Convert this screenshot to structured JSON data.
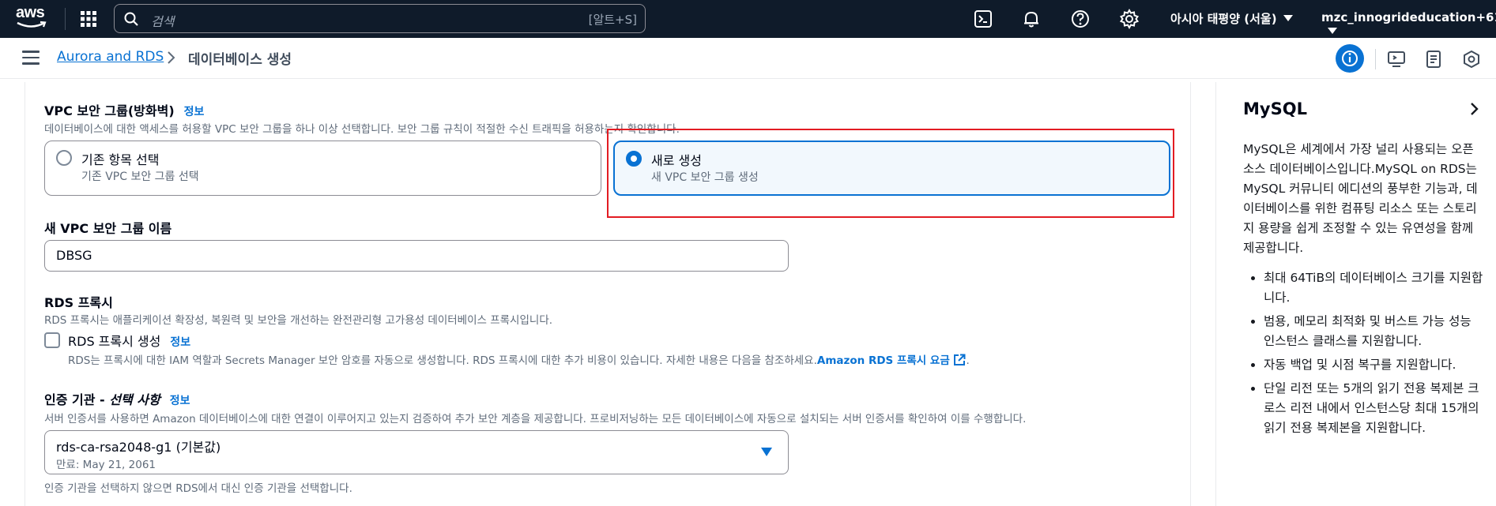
{
  "topbar": {
    "logo": "aws",
    "search_placeholder": "검색",
    "search_shortcut": "[알트+S]",
    "region": "아시아 태평양 (서울)",
    "account": "mzc_innogrideducation+61"
  },
  "breadcrumb": {
    "root": "Aurora and RDS",
    "current": "데이터베이스 생성"
  },
  "vpc_sg": {
    "label": "VPC 보안 그룹(방화벽)",
    "info": "정보",
    "desc": "데이터베이스에 대한 액세스를 허용할 VPC 보안 그룹을 하나 이상 선택합니다. 보안 그룹 규칙이 적절한 수신 트래픽을 허용하는지 확인합니다.",
    "options": [
      {
        "title": "기존 항목 선택",
        "sub": "기존 VPC 보안 그룹 선택",
        "selected": false
      },
      {
        "title": "새로 생성",
        "sub": "새 VPC 보안 그룹 생성",
        "selected": true
      }
    ]
  },
  "new_sg_name": {
    "label": "새 VPC 보안 그룹 이름",
    "value": "DBSG"
  },
  "rds_proxy": {
    "label": "RDS 프록시",
    "desc": "RDS 프록시는 애플리케이션 확장성, 복원력 및 보안을 개선하는 완전관리형 고가용성 데이터베이스 프록시입니다.",
    "checkbox_label": "RDS 프록시 생성",
    "info": "정보",
    "checkbox_desc": "RDS는 프록시에 대한 IAM 역할과 Secrets Manager 보안 암호를 자동으로 생성합니다. RDS 프록시에 대한 추가 비용이 있습니다. 자세한 내용은 다음을 참조하세요.",
    "link": "Amazon RDS 프록시 요금",
    "checked": false
  },
  "ca": {
    "label_main": "인증 기관 - ",
    "label_opt": "선택 사항",
    "info": "정보",
    "desc": "서버 인증서를 사용하면 Amazon 데이터베이스에 대한 연결이 이루어지고 있는지 검증하여 추가 보안 계층을 제공합니다. 프로비저닝하는 모든 데이터베이스에 자동으로 설치되는 서버 인증서를 확인하여 이를 수행합니다.",
    "selected": "rds-ca-rsa2048-g1 (기본값)",
    "expiry": "만료: May 21, 2061",
    "footnote": "인증 기관을 선택하지 않으면 RDS에서 대신 인증 기관을 선택합니다."
  },
  "help_panel": {
    "title": "MySQL",
    "body": "MySQL은 세계에서 가장 널리 사용되는 오픈 소스 데이터베이스입니다.MySQL on RDS는 MySQL 커뮤니티 에디션의 풍부한 기능과, 데이터베이스를 위한 컴퓨팅 리소스 또는 스토리지 용량을 쉽게 조정할 수 있는 유연성을 함께 제공합니다.",
    "bullets": [
      "최대 64TiB의 데이터베이스 크기를 지원합니다.",
      "범용, 메모리 최적화 및 버스트 가능 성능 인스턴스 클래스를 지원합니다.",
      "자동 백업 및 시점 복구를 지원합니다.",
      "단일 리전 또는 5개의 읽기 전용 복제본 크로스 리전 내에서 인스턴스당 최대 15개의 읽기 전용 복제본을 지원합니다."
    ]
  },
  "colors": {
    "topbar_bg": "#0f1b2a",
    "link": "#0972d3",
    "highlight": "#e31c23"
  }
}
